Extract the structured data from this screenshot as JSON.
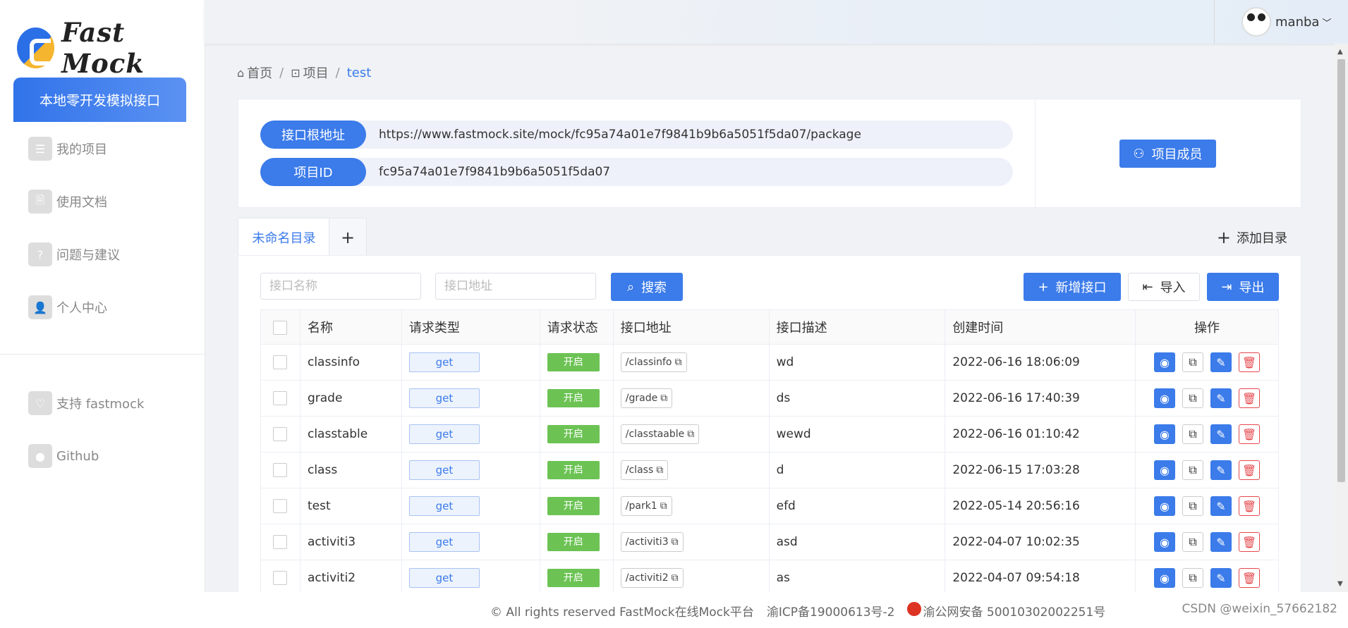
{
  "app": {
    "logo_text": "Fast Mock"
  },
  "sidebar": {
    "promo_label": "本地零开发模拟接口",
    "items": [
      {
        "label": "我的项目",
        "icon": "list-icon",
        "glyph": "☰"
      },
      {
        "label": "使用文档",
        "icon": "document-icon",
        "glyph": "🗎"
      },
      {
        "label": "问题与建议",
        "icon": "question-icon",
        "glyph": "?"
      },
      {
        "label": "个人中心",
        "icon": "user-icon",
        "glyph": "👤"
      }
    ],
    "bottom_items": [
      {
        "label": "支持 fastmock",
        "icon": "heart-icon",
        "glyph": "♡"
      },
      {
        "label": "Github",
        "icon": "github-icon",
        "glyph": "●"
      }
    ]
  },
  "header": {
    "username": "manba"
  },
  "breadcrumb": {
    "home": "首页",
    "project": "项目",
    "current": "test",
    "separator": "/"
  },
  "info": {
    "root_label": "接口根地址",
    "root_value": "https://www.fastmock.site/mock/fc95a74a01e7f9841b9b6a5051f5da07/package",
    "id_label": "项目ID",
    "id_value": "fc95a74a01e7f9841b9b6a5051f5da07",
    "members_button": "项目成员"
  },
  "tabs": {
    "active": "未命名目录",
    "add_tab": "+",
    "add_directory": "添加目录"
  },
  "toolbar": {
    "name_placeholder": "接口名称",
    "url_placeholder": "接口地址",
    "search_button": "搜索",
    "new_button": "新增接口",
    "import_button": "导入",
    "export_button": "导出"
  },
  "table": {
    "headers": [
      "名称",
      "请求类型",
      "请求状态",
      "接口地址",
      "接口描述",
      "创建时间",
      "操作"
    ],
    "rows": [
      {
        "name": "classinfo",
        "method": "get",
        "status": "开启",
        "url": "/classinfo",
        "desc": "wd",
        "created": "2022-06-16 18:06:09"
      },
      {
        "name": "grade",
        "method": "get",
        "status": "开启",
        "url": "/grade",
        "desc": "ds",
        "created": "2022-06-16 17:40:39"
      },
      {
        "name": "classtable",
        "method": "get",
        "status": "开启",
        "url": "/classtaable",
        "desc": "wewd",
        "created": "2022-06-16 01:10:42"
      },
      {
        "name": "class",
        "method": "get",
        "status": "开启",
        "url": "/class",
        "desc": "d",
        "created": "2022-06-15 17:03:28"
      },
      {
        "name": "test",
        "method": "get",
        "status": "开启",
        "url": "/park1",
        "desc": "efd",
        "created": "2022-05-14 20:56:16"
      },
      {
        "name": "activiti3",
        "method": "get",
        "status": "开启",
        "url": "/activiti3",
        "desc": "asd",
        "created": "2022-04-07 10:02:35"
      },
      {
        "name": "activiti2",
        "method": "get",
        "status": "开启",
        "url": "/activiti2",
        "desc": "as",
        "created": "2022-04-07 09:54:18"
      }
    ]
  },
  "footer": {
    "copyright": "© All rights reserved FastMock在线Mock平台",
    "icp": "渝ICP备19000613号-2",
    "police": "渝公网安备 50010302002251号",
    "watermark": "CSDN @weixin_57662182"
  },
  "colors": {
    "primary": "#3b7bea",
    "success": "#6cc354",
    "danger": "#e5484d"
  }
}
